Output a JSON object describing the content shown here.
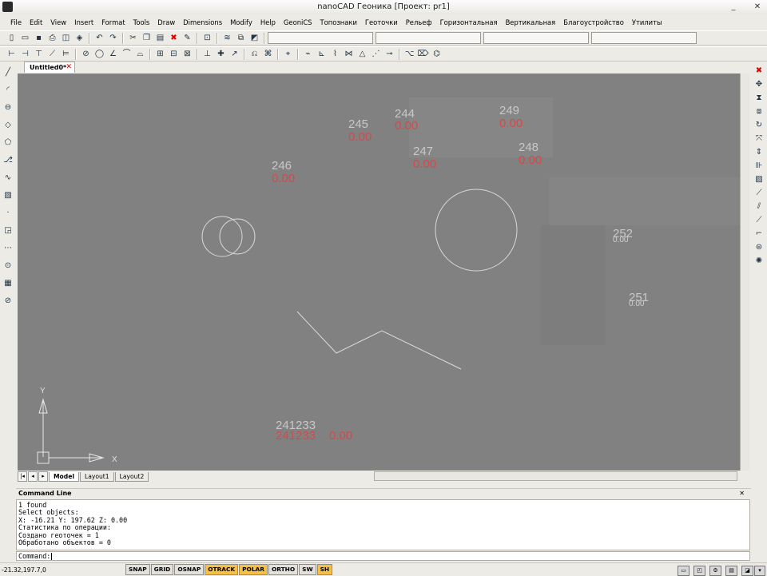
{
  "window": {
    "title": "nanoCAD Геоника [Проект: pr1]",
    "minimize": "_",
    "close": "✕"
  },
  "menu": [
    "File",
    "Edit",
    "View",
    "Insert",
    "Format",
    "Tools",
    "Draw",
    "Dimensions",
    "Modify",
    "Help",
    "GeoniCS",
    "Топознаки",
    "Геоточки",
    "Рельеф",
    "Горизонтальная",
    "Вертикальная",
    "Благоустройство",
    "Утилиты"
  ],
  "document_tab": {
    "label": "Untitled0*"
  },
  "drawing": {
    "points": [
      {
        "id": "245",
        "elev": "0.00"
      },
      {
        "id": "244",
        "elev": "0.00"
      },
      {
        "id": "249",
        "elev": "0.00"
      },
      {
        "id": "246",
        "elev": "0.00"
      },
      {
        "id": "247",
        "elev": "0.00"
      },
      {
        "id": "248",
        "elev": "0.00"
      },
      {
        "id": "252",
        "elev": "0.00"
      },
      {
        "id": "251",
        "elev": "0.00"
      }
    ],
    "cluster_id": "241233",
    "cluster_elev": "0.00",
    "ucs_y": "Y",
    "ucs_x": "X"
  },
  "layout_tabs": [
    "Model",
    "Layout1",
    "Layout2"
  ],
  "command_line": {
    "header": "Command Line",
    "lines": [
      "1 found",
      "Select objects:",
      "X: -16.21 Y: 197.62 Z: 0.00",
      "Статистика по операции:",
      "Создано геоточек    = 1",
      "Обработано объектов = 0"
    ],
    "prompt": "Command:"
  },
  "status": {
    "coords": "-21.32,197.7,0",
    "toggles": [
      {
        "label": "SNAP",
        "on": false
      },
      {
        "label": "GRID",
        "on": false
      },
      {
        "label": "OSNAP",
        "on": false
      },
      {
        "label": "OTRACK",
        "on": true
      },
      {
        "label": "POLAR",
        "on": true
      },
      {
        "label": "ORTHO",
        "on": false
      },
      {
        "label": "SW",
        "on": false
      },
      {
        "label": "SH",
        "on": true
      }
    ]
  },
  "colors": {
    "viewport": "#818181",
    "point_label": "#c0c0c0",
    "elevation_label": "#d04848",
    "accent_toggle": "#f6c046"
  }
}
